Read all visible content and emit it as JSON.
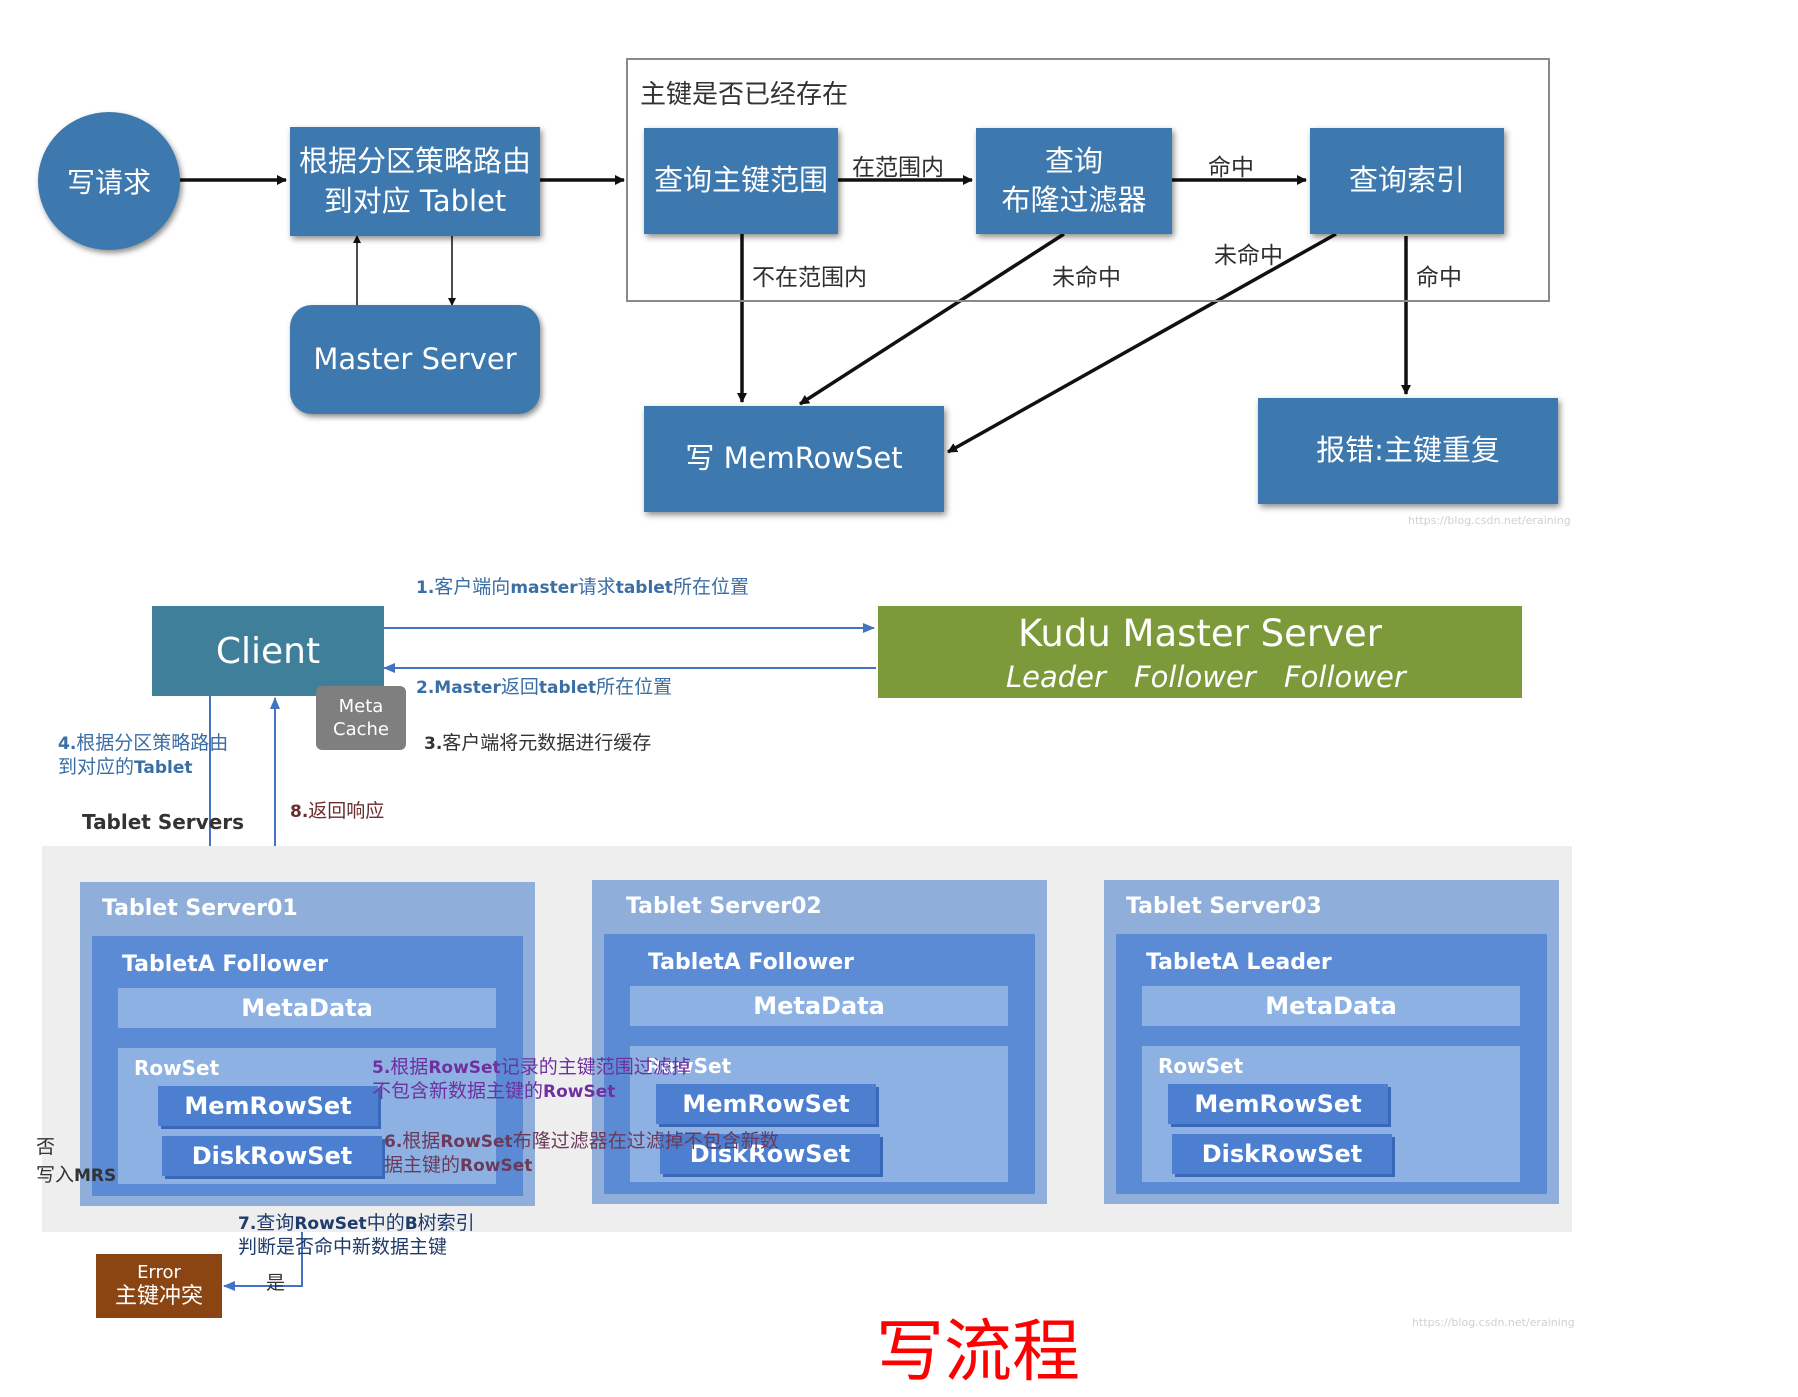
{
  "top": {
    "write_request": "写请求",
    "route_line1": "根据分区策略路由",
    "route_line2": "到对应 Tablet",
    "master_server": "Master Server",
    "check_group_title": "主键是否已经存在",
    "query_range": "查询主键范围",
    "query_bloom_line1": "查询",
    "query_bloom_line2": "布隆过滤器",
    "query_index": "查询索引",
    "write_memrowset": "写 MemRowSet",
    "error_duplicate": "报错:主键重复",
    "in_range": "在范围内",
    "not_in_range": "不在范围内",
    "hit_1": "命中",
    "miss_1": "未命中",
    "miss_2": "未命中",
    "hit_2": "命中",
    "watermark": "https://blog.csdn.net/eraining"
  },
  "bottom": {
    "client": "Client",
    "meta_cache_line1": "Meta",
    "meta_cache_line2": "Cache",
    "kudu_master_title": "Kudu Master Server",
    "kudu_roles": [
      "Leader",
      "Follower",
      "Follower"
    ],
    "step1": {
      "num": "1.",
      "a": "客户端向",
      "b": "master",
      "c": "请求",
      "d": "tablet",
      "e": "所在位置"
    },
    "step2": {
      "num": "2.",
      "a": "Master",
      "b": "返回",
      "c": "tablet",
      "d": "所在位置"
    },
    "step3": {
      "num": "3.",
      "a": "客户端将元数据进行缓存"
    },
    "step4": {
      "num": "4.",
      "line1": "根据分区策略路由",
      "line2a": "到对应的",
      "line2b": "Tablet"
    },
    "step8": {
      "num": "8.",
      "a": "返回响应"
    },
    "tablet_servers_label": "Tablet Servers",
    "servers": [
      {
        "title": "Tablet Server01",
        "tablet": "TabletA Follower",
        "metadata": "MetaData",
        "rowset": "RowSet",
        "memrowset": "MemRowSet",
        "diskrowset": "DiskRowSet"
      },
      {
        "title": "Tablet Server02",
        "tablet": "TabletA Follower",
        "metadata": "MetaData",
        "rowset": "RowSet",
        "memrowset": "MemRowSet",
        "diskrowset": "DiskRowSet"
      },
      {
        "title": "Tablet Server03",
        "tablet": "TabletA Leader",
        "metadata": "MetaData",
        "rowset": "RowSet",
        "memrowset": "MemRowSet",
        "diskrowset": "DiskRowSet"
      }
    ],
    "step5": {
      "num": "5.",
      "a": "根据",
      "b": "RowSet",
      "c": "记录的主键范围过滤掉",
      "d": "不包含新数据主键的",
      "e": "RowSet"
    },
    "step6": {
      "num": "6.",
      "a": "根据",
      "b": "RowSet",
      "c": "布隆过滤器在过滤掉不包含新数",
      "d": "据主键的",
      "e": "RowSet"
    },
    "step7": {
      "num": "7.",
      "a": "查询",
      "b": "RowSet",
      "c": "中的",
      "d": "B",
      "e": "树索引",
      "f": "判断是否命中新数据主键"
    },
    "no_label": "否",
    "write_mrs_a": "写入",
    "write_mrs_b": "MRS",
    "yes_label": "是",
    "error_line1": "Error",
    "error_line2": "主键冲突",
    "title": "写流程",
    "watermark": "https://blog.csdn.net/eraining"
  },
  "colors": {
    "top_box": "#3d78ae",
    "client": "#3f7f99",
    "kudu_master": "#7c9a3a",
    "meta_cache": "#7f7f7f",
    "server_outer": "#8fafda",
    "server_inner": "#5b8bd5",
    "error_box": "#8b4513",
    "step_blue": "#3a6ea5",
    "step_purple": "#7030a0",
    "step8": "#6b2d2d",
    "title_red": "#ff0000"
  }
}
